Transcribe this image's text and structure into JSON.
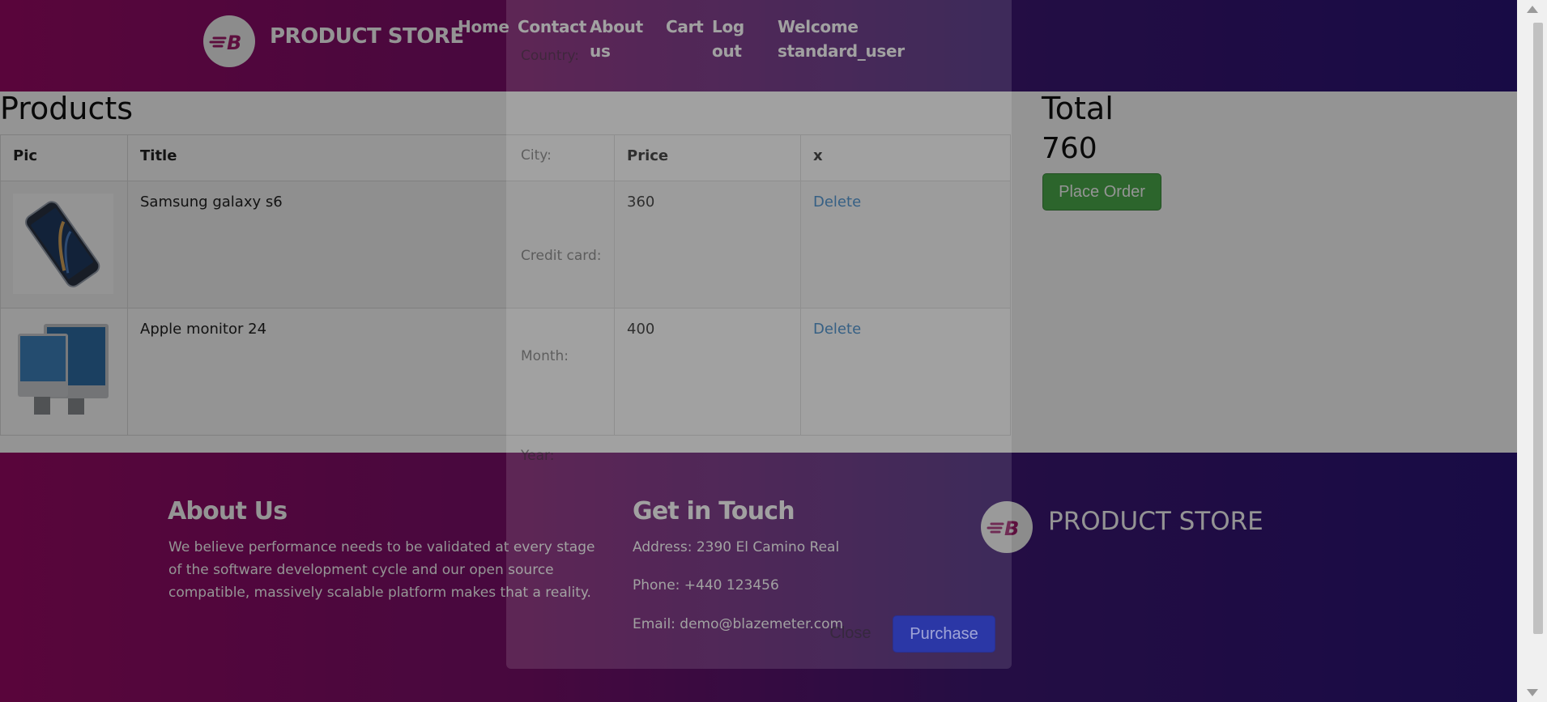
{
  "header": {
    "brand": "PRODUCT STORE",
    "logo_letter": "B",
    "nav": [
      {
        "label": "Home"
      },
      {
        "label": "Contact"
      },
      {
        "label": "About\nus"
      },
      {
        "label": "Cart"
      },
      {
        "label": "Log\nout"
      },
      {
        "label": "Welcome\nstandard_user"
      }
    ]
  },
  "products": {
    "title": "Products",
    "columns": [
      "Pic",
      "Title",
      "Price",
      "x"
    ],
    "rows": [
      {
        "image": "samsung-galaxy-s6-image",
        "title": "Samsung galaxy s6",
        "price": "360",
        "action": "Delete"
      },
      {
        "image": "apple-monitor-24-image",
        "title": "Apple monitor 24",
        "price": "400",
        "action": "Delete"
      }
    ]
  },
  "total": {
    "title": "Total",
    "value": "760",
    "place_order_label": "Place Order"
  },
  "footer": {
    "about_title": "About Us",
    "about_text": "We believe performance needs to be validated at every stage of the software development cycle and our open source compatible, massively scalable platform makes that a reality.",
    "contact_title": "Get in Touch",
    "address": "Address: 2390 El Camino Real",
    "phone": "Phone: +440 123456",
    "email": "Email: demo@blazemeter.com",
    "brand": "PRODUCT STORE"
  },
  "modal": {
    "labels": [
      "Country:",
      "City:",
      "Credit card:",
      "Month:",
      "Year:"
    ],
    "close_label": "Close",
    "purchase_label": "Purchase"
  },
  "colors": {
    "accent_green": "#4cae4c",
    "link_blue": "#2f80c9",
    "purchase_blue": "#2b37a6",
    "gradient_start": "#9a0a66",
    "gradient_end": "#2a1478"
  }
}
